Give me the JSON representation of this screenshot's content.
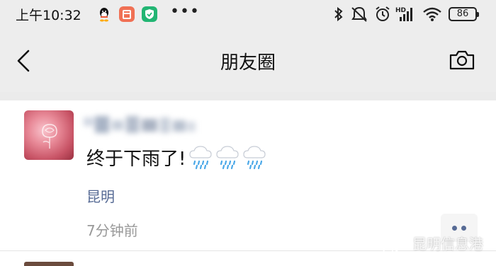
{
  "status_bar": {
    "time": "上午10:32",
    "overflow": "•••",
    "battery": "86",
    "icons": [
      "qq-icon",
      "app-icon",
      "shield-app-icon",
      "bluetooth-icon",
      "mute-icon",
      "alarm-icon",
      "hd-signal-icon",
      "wifi-icon",
      "battery-icon"
    ]
  },
  "nav": {
    "title": "朋友圈",
    "back_icon": "back-icon",
    "camera_icon": "camera-icon"
  },
  "post": {
    "text": "终于下雨了!",
    "emoji": [
      "rain-cloud-emoji",
      "rain-cloud-emoji",
      "rain-cloud-emoji"
    ],
    "location": "昆明",
    "time": "7分钟前",
    "more_icon": "more-icon"
  },
  "watermark": "昆明信息港",
  "colors": {
    "header_bg": "#ededed",
    "link_blue": "#576b95",
    "time_gray": "#999999"
  }
}
